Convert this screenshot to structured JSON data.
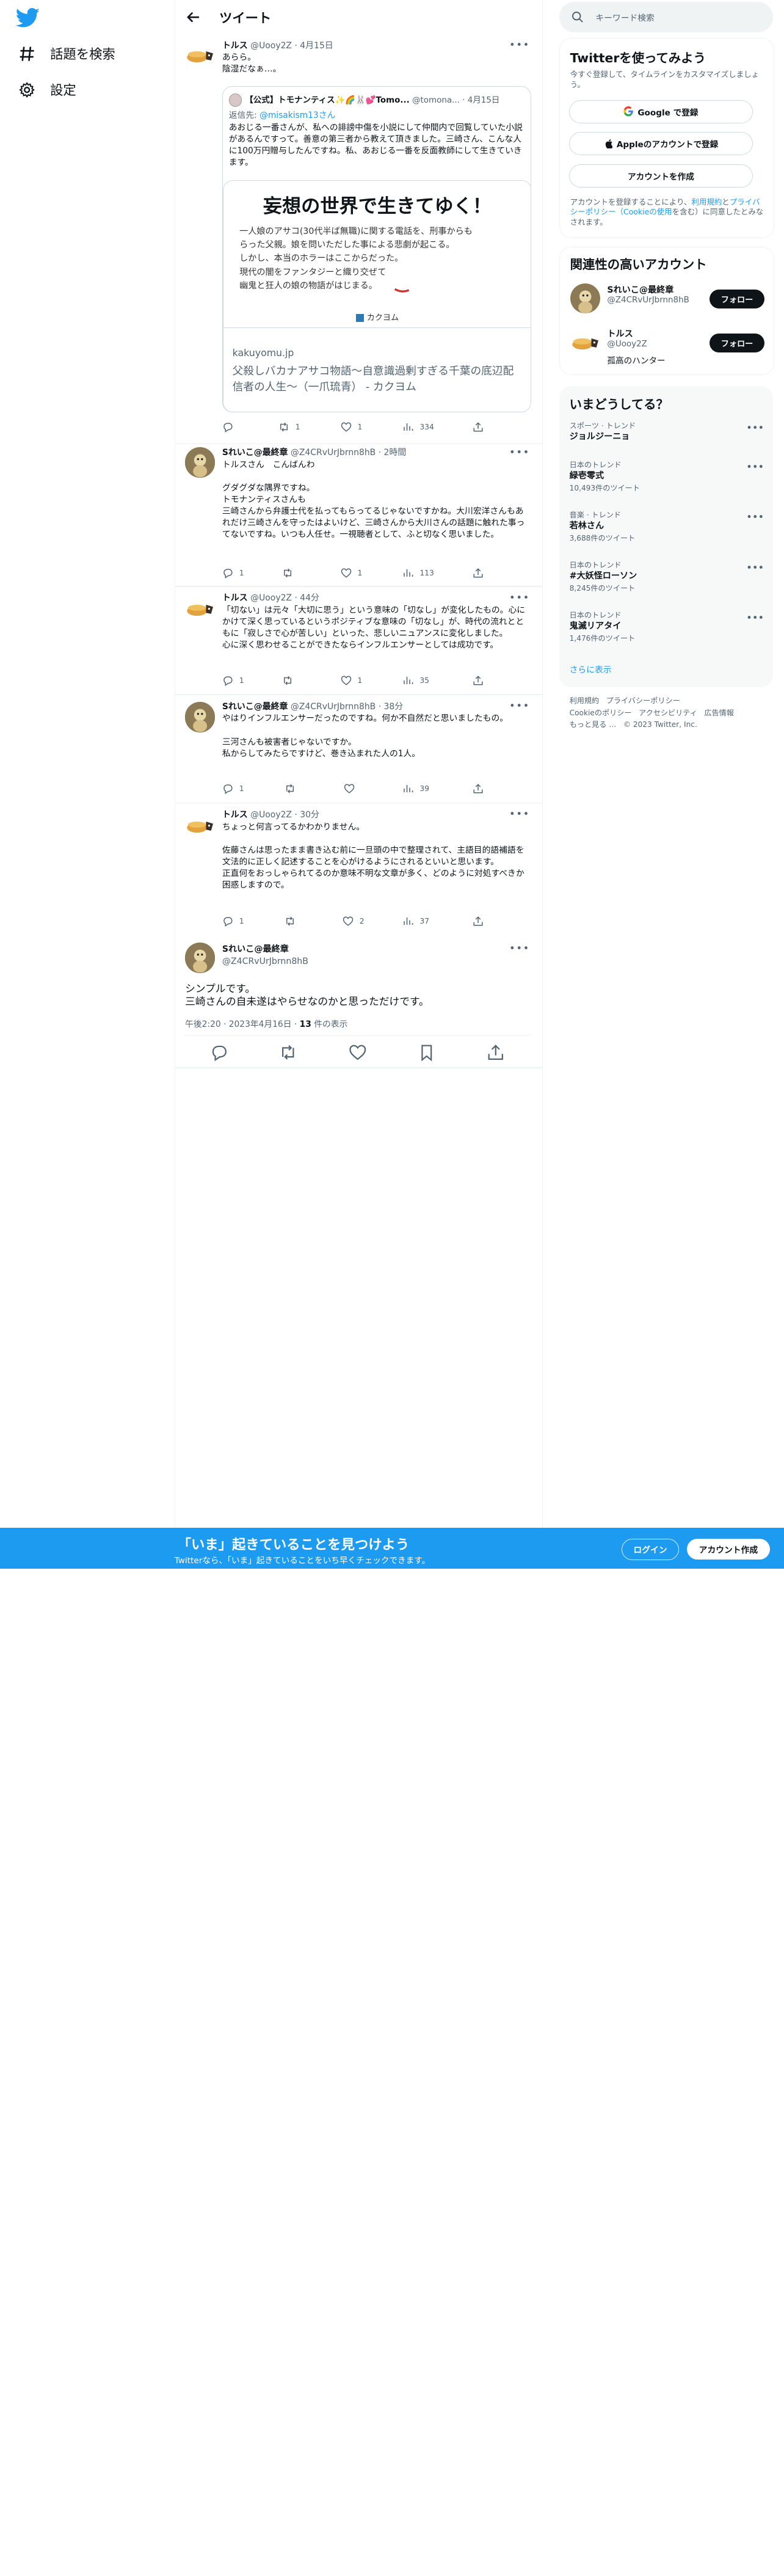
{
  "nav": {
    "explore_label": "話題を検索",
    "settings_label": "設定"
  },
  "header": {
    "title": "ツイート"
  },
  "tweets": [
    {
      "name": "トルス",
      "handle": "@Uooy2Z",
      "time": "· 4月15日",
      "text": "あらら。\n陰湿だなぁ…。",
      "replies": "",
      "retweets": "1",
      "likes": "1",
      "views": "334"
    },
    {
      "name": "Sれいこ@最終章",
      "handle": "@Z4CRvUrJbrnn8hB",
      "time": "· 2時間",
      "text": "トルスさん　こんばんわ\n\nグダグダな隅界ですね。\nトモナンティスさんも\n三崎さんから弁護士代を払ってもらってるじゃないですかね。大川宏洋さんもあれだけ三崎さんを守ったはよいけど、三崎さんから大川さんの話題に触れた事ってないですね。いつも人任せ。一視聴者として、ふと切なく思いました。",
      "replies": "1",
      "retweets": "",
      "likes": "1",
      "views": "113"
    },
    {
      "name": "トルス",
      "handle": "@Uooy2Z",
      "time": "· 44分",
      "text": "「切ない」は元々「大切に思う」という意味の「切なし」が変化したもの。心にかけて深く思っているというポジティブな意味の「切なし」が、時代の流れとともに「寂しさで心が苦しい」といった、悲しいニュアンスに変化しました。\n心に深く思わせることができたならインフルエンサーとしては成功です。",
      "replies": "1",
      "retweets": "",
      "likes": "1",
      "views": "35"
    },
    {
      "name": "Sれいこ@最終章",
      "handle": "@Z4CRvUrJbrnn8hB",
      "time": "· 38分",
      "text": "やはりインフルエンサーだったのですね。何か不自然だと思いましたもの。\n\n三河さんも被害者じゃないですか。\n私からしてみたらですけど、巻き込まれた人の1人。",
      "replies": "1",
      "retweets": "",
      "likes": "",
      "views": "39"
    },
    {
      "name": "トルス",
      "handle": "@Uooy2Z",
      "time": "· 30分",
      "text": "ちょっと何言ってるかわかりません。\n\n佐藤さんは思ったまま書き込む前に一旦頭の中で整理されて、主語目的語補語を文法的に正しく記述することを心がけるようにされるといいと思います。\n正直何をおっしゃられてるのか意味不明な文章が多く、どのように対処すべきか困惑しますので。",
      "replies": "1",
      "retweets": "",
      "likes": "2",
      "views": "37"
    }
  ],
  "quote": {
    "name": "【公式】トモナンティス✨🌈🐰💕Tomo...",
    "handle": "@tomona...",
    "time": "· 4月15日",
    "reply_to_label": "返信先: ",
    "reply_to": "@misakism13さん",
    "text": "あおじる一番さんが、私への誹謗中傷を小説にして仲間内で回覧していた小説があるんですって。善意の第三者から教えて頂きました。三崎さん、こんな人に100万円贈与したんですね。私、あおじる一番を反面教師にして生きていきます。",
    "card": {
      "image_title": "妄想の世界で生きてゆく！",
      "image_lines": "一人娘のアサコ(30代半ば無職)に関する電話を、刑事からも\nらった父親。娘を問いただした事による悲劇が起こる。\nしかし、本当のホラーはここからだった。\n現代の闇をファンタジーと織り交ぜて\n幽鬼と狂人の娘の物語がはじまる。",
      "image_brand": "カクヨム",
      "domain": "kakuyomu.jp",
      "description": "父殺しバカナアサコ物語～自意識過剰すぎる千葉の底辺配信者の人生～（一爪琉青） - カクヨム"
    }
  },
  "main_tweet": {
    "name": "Sれいこ@最終章",
    "handle": "@Z4CRvUrJbrnn8hB",
    "text": "シンプルです。\n三崎さんの自未遂はやらせなのかと思っただけです。",
    "timestamp": "午後2:20 · 2023年4月16日 · ",
    "views_count": "13",
    "views_label": " 件の表示"
  },
  "sidebar": {
    "search_placeholder": "キーワード検索",
    "signup": {
      "title": "Twitterを使ってみよう",
      "subtitle": "今すぐ登録して、タイムラインをカスタマイズしましょう。",
      "google_label": "Google で登録",
      "apple_label": "Appleのアカウントで登録",
      "create_label": "アカウントを作成",
      "terms_prefix": "アカウントを登録することにより、",
      "terms_link": "利用規約",
      "terms_and": "と",
      "privacy_link": "プライバシーポリシー（Cookieの使用",
      "terms_suffix": "を含む）に同意したとみなされます。"
    },
    "related": {
      "title": "関連性の高いアカウント",
      "accounts": [
        {
          "name": "Sれいこ@最終章",
          "handle": "@Z4CRvUrJbrnn8hB",
          "bio": "",
          "follow": "フォロー"
        },
        {
          "name": "トルス",
          "handle": "@Uooy2Z",
          "bio": "孤高のハンター",
          "follow": "フォロー"
        }
      ]
    },
    "trends": {
      "title": "いまどうしてる？",
      "items": [
        {
          "category": "スポーツ · トレンド",
          "name": "ジョルジーニョ",
          "count": ""
        },
        {
          "category": "日本のトレンド",
          "name": "緑壱零式",
          "count": "10,493件のツイート"
        },
        {
          "category": "音楽 · トレンド",
          "name": "若林さん",
          "count": "3,688件のツイート"
        },
        {
          "category": "日本のトレンド",
          "name": "#大妖怪ローソン",
          "count": "8,245件のツイート"
        },
        {
          "category": "日本のトレンド",
          "name": "鬼滅リアタイ",
          "count": "1,476件のツイート"
        }
      ],
      "show_more": "さらに表示"
    },
    "footer": {
      "links": [
        "利用規約",
        "プライバシーポリシー",
        "Cookieのポリシー",
        "アクセシビリティ",
        "広告情報",
        "もっと見る …"
      ],
      "copyright": "© 2023 Twitter, Inc."
    }
  },
  "bottom_bar": {
    "title": "「いま」起きていることを見つけよう",
    "subtitle": "Twitterなら、「いま」起きていることをいち早くチェックできます。",
    "login": "ログイン",
    "signup": "アカウント作成"
  },
  "colors": {
    "accent": "#1d9bf0",
    "text": "#0f1419",
    "muted": "#536471",
    "border": "#eff3f4"
  }
}
